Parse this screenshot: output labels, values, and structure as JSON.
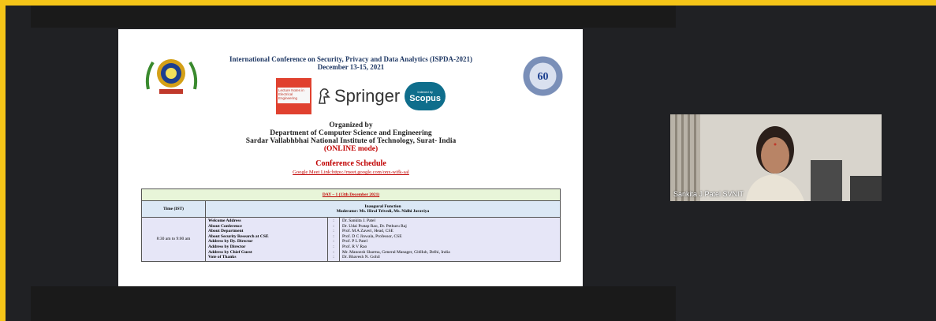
{
  "slide": {
    "conference_title": "International Conference on Security, Privacy and Data Analytics (ISPDA-2021)",
    "conference_dates": "December 13-15, 2021",
    "lnee_label": "Lecture Notes in Electrical Engineering",
    "springer_label": "Springer",
    "scopus_top": "Indexed by",
    "scopus_label": "Scopus",
    "right_logo_text": "60th ANNIVERSARY",
    "organized_by": "Organized by",
    "department": "Department of Computer Science and Engineering",
    "institute": "Sardar Vallabhbhai National Institute of Technology, Surat- India",
    "mode": "(ONLINE mode)",
    "schedule_title": "Conference Schedule",
    "meet_link": "Google Meet Link:https://meet.google.com/onx-wifk-sal",
    "table": {
      "day_label": "DAY – 1 (13th December 2021)",
      "time_header": "Time (IST)",
      "function_title": "Inaugural Function",
      "moderator": "Moderator: Ms. Hiral Trivedi, Ms. Nidhi Joraviya",
      "time_value": "8:30 am to 9:00 am",
      "items": [
        {
          "item": "Welcome Address",
          "person": "Dr. Sankita J. Patel"
        },
        {
          "item": "About Conference",
          "person": "Dr. Udai Pratap Rao, Dr. Pethuru Raj"
        },
        {
          "item": "About Department",
          "person": "Prof. M A Zaveri, Head, CSE"
        },
        {
          "item": "About Security Research at CSE",
          "person": "Prof. D C Jinwala, Professor, CSE"
        },
        {
          "item": "Address by Dy. Director",
          "person": "Prof. P L Patel"
        },
        {
          "item": "Address by Director",
          "person": "Prof. R V Rao"
        },
        {
          "item": "Address by Chief Guest",
          "person": "Mr. Manoesh Sharma, General Manager, GitHub, Delhi, India"
        },
        {
          "item": "Vote of Thanks",
          "person": "Dr. Bhavesh N. Gohil"
        }
      ]
    }
  },
  "participant": {
    "name": "Sankita J Patel SVNIT"
  },
  "colors": {
    "frame_border": "#f5c518",
    "meeting_bg": "#202124",
    "accent_red": "#c00000",
    "title_blue": "#1f3864"
  }
}
